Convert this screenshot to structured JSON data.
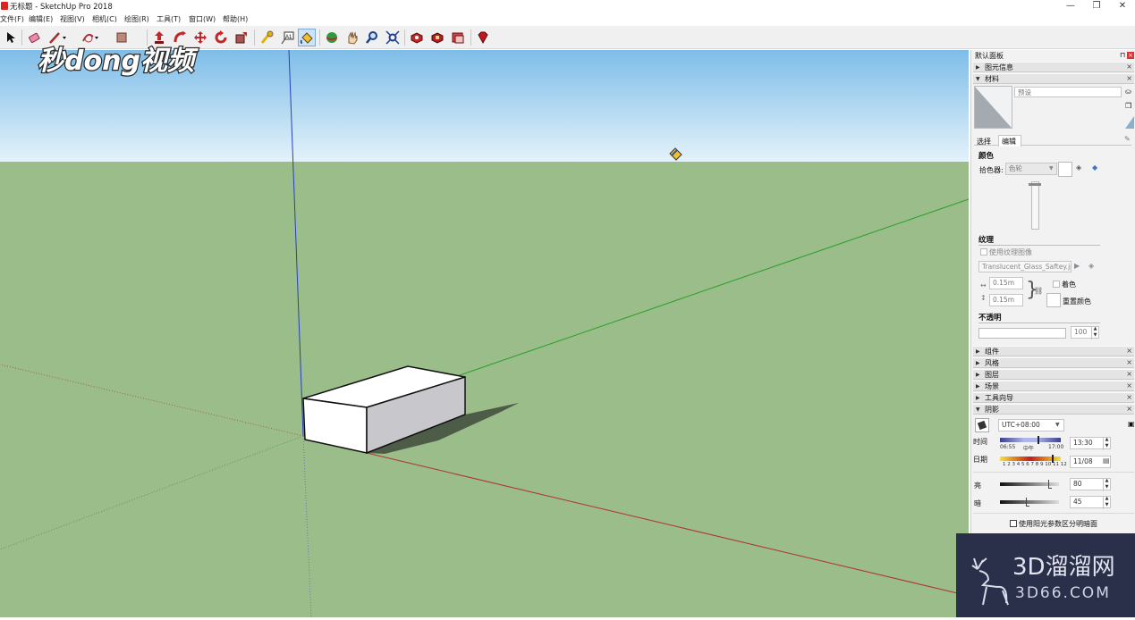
{
  "window": {
    "title": "无标题 - SketchUp Pro 2018",
    "controls": [
      "—",
      "❐",
      "✕"
    ]
  },
  "menu": [
    {
      "label": "文件(F)"
    },
    {
      "label": "编辑(E)"
    },
    {
      "label": "视图(V)"
    },
    {
      "label": "相机(C)"
    },
    {
      "label": "绘图(R)"
    },
    {
      "label": "工具(T)"
    },
    {
      "label": "窗口(W)"
    },
    {
      "label": "帮助(H)"
    }
  ],
  "toolbar": {
    "tools": [
      "select-icon",
      "eraser-icon",
      "line-icon",
      "arc-icon",
      "rectangle-icon",
      "push-pull-icon",
      "follow-me-icon",
      "move-icon",
      "rotate-icon",
      "scale-icon",
      "tape-measure-icon",
      "text-icon",
      "paint-bucket-icon",
      "orbit-icon",
      "pan-icon",
      "zoom-icon",
      "zoom-extents-icon",
      "3d-warehouse-icon",
      "extension-warehouse-icon",
      "layout-icon",
      "ruby-icon"
    ],
    "active_tool": "paint-bucket-icon"
  },
  "watermark_topleft": {
    "text": "秒dong视频"
  },
  "watermark_corner": {
    "line1": "3D溜溜网",
    "line2": "3D66.COM"
  },
  "panel": {
    "title": "默认面板",
    "sections_top": [
      {
        "label": "图元信息",
        "expanded": false
      },
      {
        "label": "材料",
        "expanded": true
      }
    ],
    "material": {
      "name_placeholder": "预设",
      "tabs": [
        "选择",
        "编辑"
      ],
      "active_tab": "编辑",
      "color_heading": "颜色",
      "picker_label": "拾色器:",
      "picker_value": "色轮",
      "texture_heading": "纹理",
      "use_texture_label": "使用纹理图像",
      "texture_file": "Translucent_Glass_Saftey.jpg",
      "width": "0.15m",
      "height": "0.15m",
      "colorize_label": "着色",
      "reset_color_label": "重置颜色",
      "opacity_heading": "不透明",
      "opacity_value": "100"
    },
    "sections_mid": [
      {
        "label": "组件",
        "expanded": false
      },
      {
        "label": "风格",
        "expanded": false
      },
      {
        "label": "图层",
        "expanded": false
      },
      {
        "label": "场景",
        "expanded": false
      },
      {
        "label": "工具向导",
        "expanded": false
      },
      {
        "label": "阴影",
        "expanded": true
      }
    ],
    "shadows": {
      "timezone": "UTC+08:00",
      "time_label": "时间",
      "time_start": "06:55",
      "time_mid": "中午",
      "time_end": "17:00",
      "time_value": "13:30",
      "date_label": "日期",
      "months": "1 2 3 4 5 6 7 8 9 10 11 12",
      "date_value": "11/08",
      "light_label": "亮",
      "light_value": "80",
      "dark_label": "暗",
      "dark_value": "45",
      "use_sun_label": "使用阳光参数区分明暗面"
    }
  }
}
